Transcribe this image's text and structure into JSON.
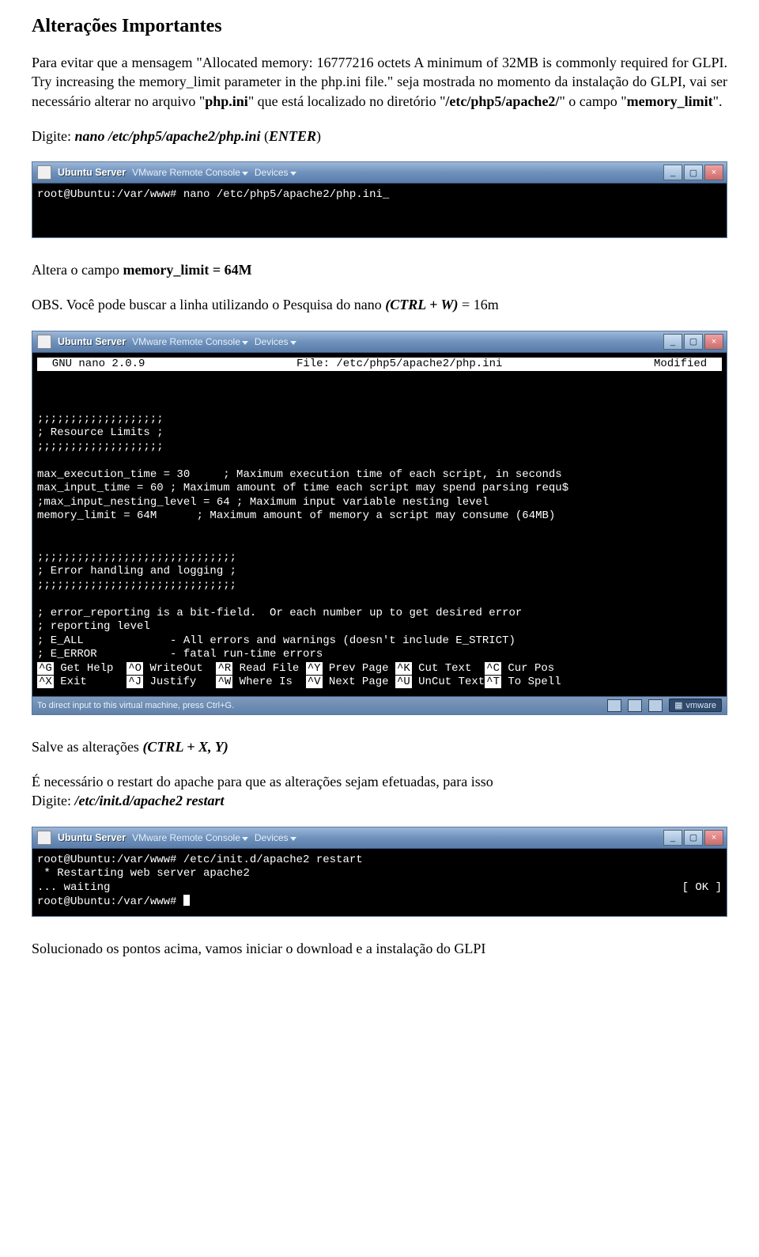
{
  "doc": {
    "title": "Alterações Importantes",
    "p1_a": "Para evitar que a mensagem \"Allocated memory: 16777216 octets A minimum of 32MB is commonly required for GLPI. Try increasing the memory_limit parameter in the php.ini file.\" seja mostrada no momento da instalação do GLPI, vai ser necessário alterar no arquivo \"",
    "p1_bold1": "php.ini",
    "p1_b": "\" que está localizado no diretório \"",
    "p1_bold2": "/etc/php5/apache2/",
    "p1_c": "\" o campo \"",
    "p1_bold3": "memory_limit",
    "p1_d": "\".",
    "p2_a": "Digite: ",
    "p2_cmd": "nano /etc/php5/apache2/php.ini",
    "p2_b": " (",
    "p2_enter": "ENTER",
    "p2_c": ")",
    "p3_a": "Altera o campo ",
    "p3_bold": "memory_limit = 64M",
    "p4_a": "OBS. Você pode buscar a linha utilizando o Pesquisa do nano ",
    "p4_ital": "(CTRL + W)",
    "p4_b": " = 16m",
    "p5_a": "Salve as alterações ",
    "p5_ital": "(CTRL + X, Y)",
    "p6_a": "É necessário o restart do apache para que as alterações sejam efetuadas, para isso",
    "p6_b": "Digite: ",
    "p6_cmd": "/etc/init.d/apache2 restart",
    "p7": "Solucionado os pontos acima, vamos iniciar o download e a instalação do GLPI"
  },
  "vmwin": {
    "title": "Ubuntu Server",
    "remote": "VMware Remote Console",
    "devices": "Devices",
    "minimize": "_",
    "maximize": "▢",
    "close": "×",
    "footer_hint": "To direct input to this virtual machine, press Ctrl+G.",
    "vmware_label": "vmware"
  },
  "term1": {
    "line1": "root@Ubuntu:/var/www# nano /etc/php5/apache2/php.ini_"
  },
  "nano": {
    "header_left": "  GNU nano 2.0.9",
    "header_center": "File: /etc/php5/apache2/php.ini",
    "header_right": "Modified  ",
    "content": ";;;;;;;;;;;;;;;;;;;\n; Resource Limits ;\n;;;;;;;;;;;;;;;;;;;\n\nmax_execution_time = 30     ; Maximum execution time of each script, in seconds\nmax_input_time = 60 ; Maximum amount of time each script may spend parsing requ$\n;max_input_nesting_level = 64 ; Maximum input variable nesting level\nmemory_limit = 64M      ; Maximum amount of memory a script may consume (64MB)\n\n\n;;;;;;;;;;;;;;;;;;;;;;;;;;;;;;\n; Error handling and logging ;\n;;;;;;;;;;;;;;;;;;;;;;;;;;;;;;\n\n; error_reporting is a bit-field.  Or each number up to get desired error\n; reporting level\n; E_ALL             - All errors and warnings (doesn't include E_STRICT)\n; E_ERROR           - fatal run-time errors",
    "help1": "^G Get Help  ^O WriteOut  ^R Read File ^Y Prev Page ^K Cut Text  ^C Cur Pos",
    "help2": "^X Exit      ^J Justify   ^W Where Is  ^V Next Page ^U UnCut Text^T To Spell"
  },
  "term3": {
    "line1": "root@Ubuntu:/var/www# /etc/init.d/apache2 restart",
    "line2": " * Restarting web server apache2",
    "line3": "... waiting",
    "line4_left": "root@Ubuntu:/var/www# ",
    "ok": "[ OK ]"
  }
}
